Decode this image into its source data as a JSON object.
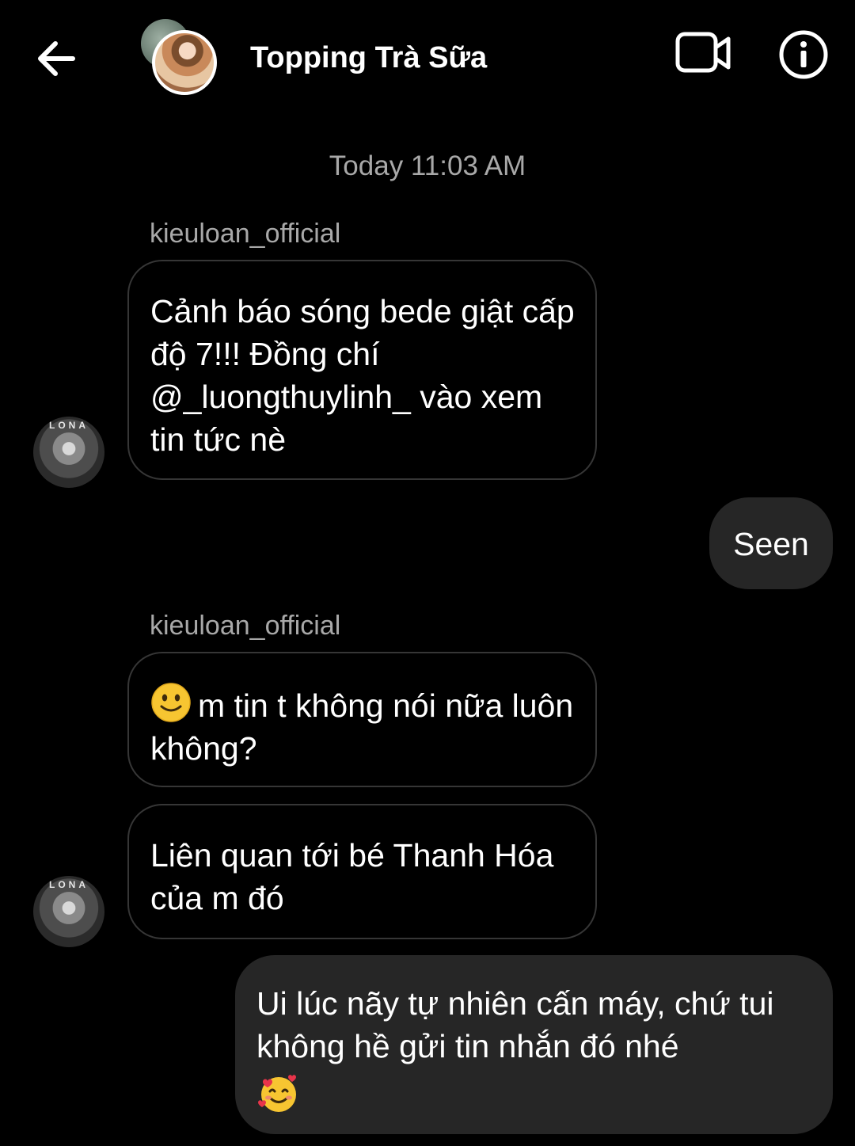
{
  "header": {
    "title": "Topping Trà Sữa"
  },
  "conversation": {
    "timestamp": "Today 11:03 AM",
    "group1": {
      "sender": "kieuloan_official",
      "message": "Cảnh báo sóng bede giật cấp độ 7!!! Đồng chí @_luongthuylinh_ vào xem tin tức nè",
      "avatar_text": "LONA"
    },
    "reply1": {
      "message": "Seen"
    },
    "group2": {
      "sender": "kieuloan_official",
      "message1": "m tin t không nói nữa luôn không?",
      "message1_emoji": "slightly-smiling-face-icon",
      "message2": "Liên quan tới bé Thanh Hóa của m đó",
      "avatar_text": "LONA"
    },
    "reply2": {
      "message": "Ui lúc nãy tự nhiên cấn máy, chứ tui không hề gửi tin nhắn đó nhé",
      "emoji": "smiling-face-with-hearts-icon"
    }
  },
  "colors": {
    "background": "#000000",
    "outgoing_bubble": "#262626",
    "incoming_border": "#363636",
    "muted_text": "#a8a8a8"
  }
}
